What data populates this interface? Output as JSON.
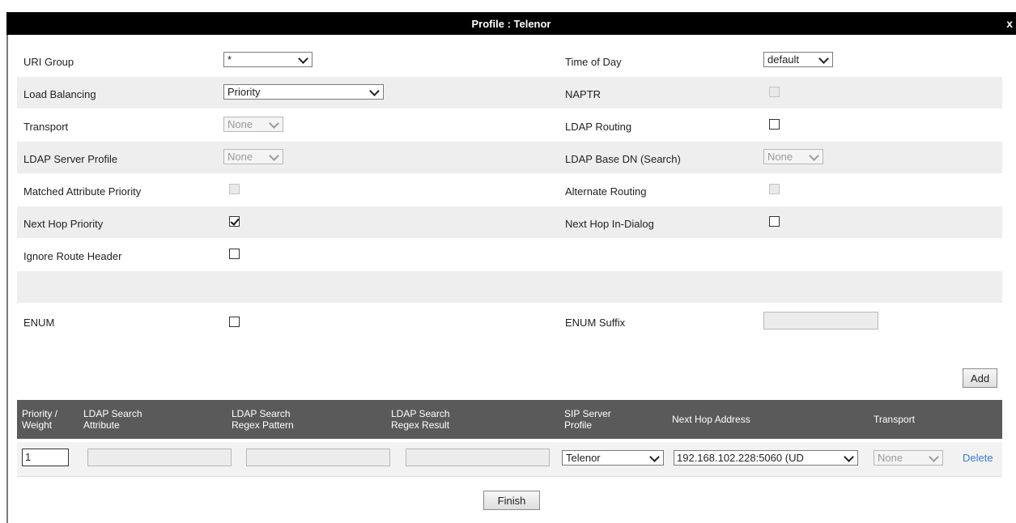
{
  "dialog": {
    "title": "Profile : Telenor",
    "close": "x"
  },
  "form": {
    "uri_group": {
      "label": "URI Group",
      "value": "*"
    },
    "time_of_day": {
      "label": "Time of Day",
      "value": "default"
    },
    "load_balancing": {
      "label": "Load Balancing",
      "value": "Priority"
    },
    "naptr": {
      "label": "NAPTR"
    },
    "transport": {
      "label": "Transport",
      "value": "None"
    },
    "ldap_routing": {
      "label": "LDAP Routing"
    },
    "ldap_server_profile": {
      "label": "LDAP Server Profile",
      "value": "None"
    },
    "ldap_base_dn": {
      "label": "LDAP Base DN (Search)",
      "value": "None"
    },
    "matched_attr_priority": {
      "label": "Matched Attribute Priority"
    },
    "alternate_routing": {
      "label": "Alternate Routing"
    },
    "next_hop_priority": {
      "label": "Next Hop Priority",
      "checked": true
    },
    "next_hop_in_dialog": {
      "label": "Next Hop In-Dialog"
    },
    "ignore_route_header": {
      "label": "Ignore Route Header"
    },
    "enum": {
      "label": "ENUM"
    },
    "enum_suffix": {
      "label": "ENUM Suffix",
      "value": ""
    }
  },
  "add_button": "Add",
  "grid": {
    "headers": {
      "priority_weight": [
        "Priority /",
        "Weight"
      ],
      "ldap_search_attr": [
        "LDAP Search",
        "Attribute"
      ],
      "ldap_regex_pattern": [
        "LDAP Search",
        "Regex Pattern"
      ],
      "ldap_regex_result": [
        "LDAP Search",
        "Regex Result"
      ],
      "sip_server_profile": [
        "SIP Server",
        "Profile"
      ],
      "next_hop_address": "Next Hop Address",
      "transport": "Transport"
    },
    "rows": [
      {
        "priority": "1",
        "sip_server_profile": "Telenor",
        "next_hop_address": "192.168.102.228:5060 (UD",
        "transport": "None",
        "delete": "Delete"
      }
    ]
  },
  "finish_button": "Finish"
}
